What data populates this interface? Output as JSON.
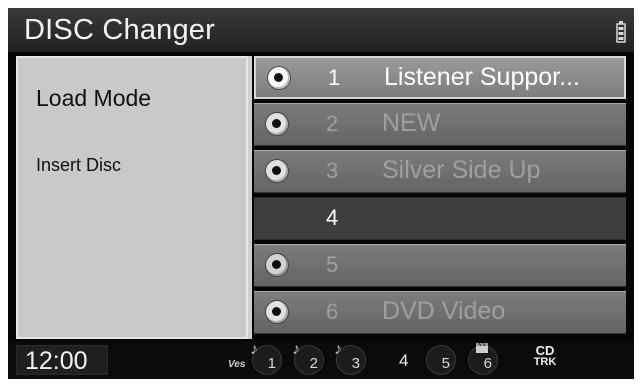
{
  "header": {
    "title": "DISC Changer",
    "status_icon": "battery-icon"
  },
  "left_panel": {
    "heading": "Load Mode",
    "items": [
      "Insert Disc"
    ]
  },
  "slots": [
    {
      "number": "1",
      "title": "Listener Suppor...",
      "state": "active"
    },
    {
      "number": "2",
      "title": "NEW",
      "state": "dim"
    },
    {
      "number": "3",
      "title": "Silver Side Up",
      "state": "dim"
    },
    {
      "number": "4",
      "title": "",
      "state": "selected"
    },
    {
      "number": "5",
      "title": "",
      "state": "empty"
    },
    {
      "number": "6",
      "title": "DVD Video",
      "state": "dim"
    }
  ],
  "bottom_bar": {
    "clock": "12:00",
    "brand": "Ves",
    "slot_buttons": [
      "1",
      "2",
      "3",
      "4",
      "5",
      "6"
    ],
    "source": {
      "top": "CD",
      "bottom": "TRK"
    }
  }
}
